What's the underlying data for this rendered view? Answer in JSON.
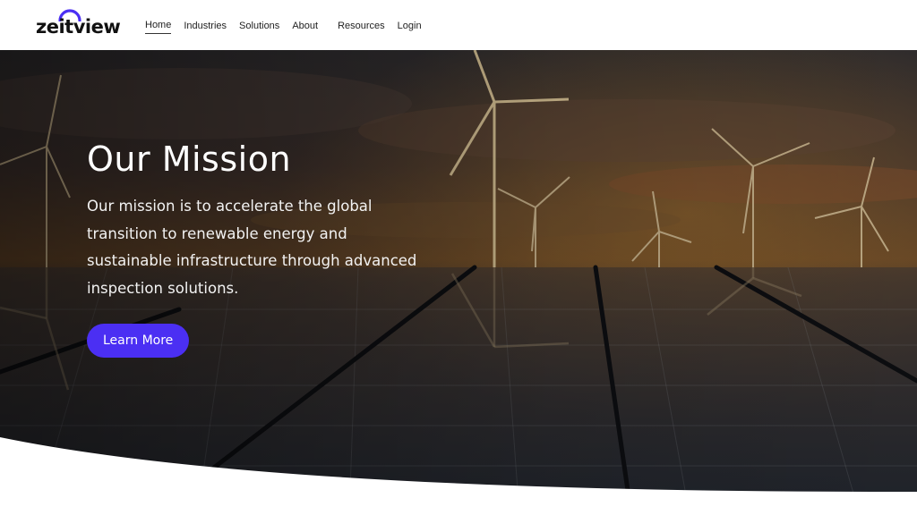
{
  "brand": {
    "name": "zeitview",
    "accent": "#4b2ff3"
  },
  "nav": {
    "items": [
      {
        "label": "Home",
        "active": true
      },
      {
        "label": "Industries"
      },
      {
        "label": "Solutions"
      },
      {
        "label": "About"
      },
      {
        "label": "Resources"
      },
      {
        "label": "Login"
      }
    ]
  },
  "hero": {
    "title": "Our Mission",
    "text": "Our mission is to accelerate the global transition to renewable energy and sustainable infrastructure through advanced inspection solutions.",
    "cta_label": "Learn More",
    "background": "wind-turbines-solar-panels-sunset-image"
  }
}
